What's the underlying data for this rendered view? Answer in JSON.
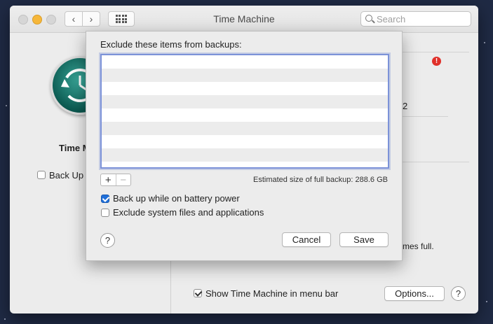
{
  "window": {
    "title": "Time Machine",
    "search": {
      "placeholder": "Search",
      "value": ""
    },
    "nav": {
      "back": "‹",
      "forward": "›"
    }
  },
  "left_pane": {
    "title_partial": "Time M",
    "backup_checkbox_partial": "Back Up",
    "backup_checked": false
  },
  "right_pane": {
    "partial_digit": "2",
    "partial_text": "mes full.",
    "show_in_menubar_label": "Show Time Machine in menu bar",
    "show_in_menubar_checked": true,
    "options_label": "Options...",
    "help_label": "?"
  },
  "sheet": {
    "heading": "Exclude these items from backups:",
    "excluded_items": [],
    "add_label": "+",
    "remove_label": "−",
    "estimated_size_label": "Estimated size of full backup: 288.6 GB",
    "battery": {
      "label": "Back up while on battery power",
      "checked": true
    },
    "exclude_system": {
      "label": "Exclude system files and applications",
      "checked": false
    },
    "help_label": "?",
    "cancel_label": "Cancel",
    "save_label": "Save"
  },
  "colors": {
    "accent_blue": "#1f6fd9",
    "warning_red": "#e0302a",
    "yellow_light": "#f6b73a",
    "tm_icon_green": "#0c5b52"
  },
  "icons": {
    "warning": "!",
    "help": "?"
  }
}
